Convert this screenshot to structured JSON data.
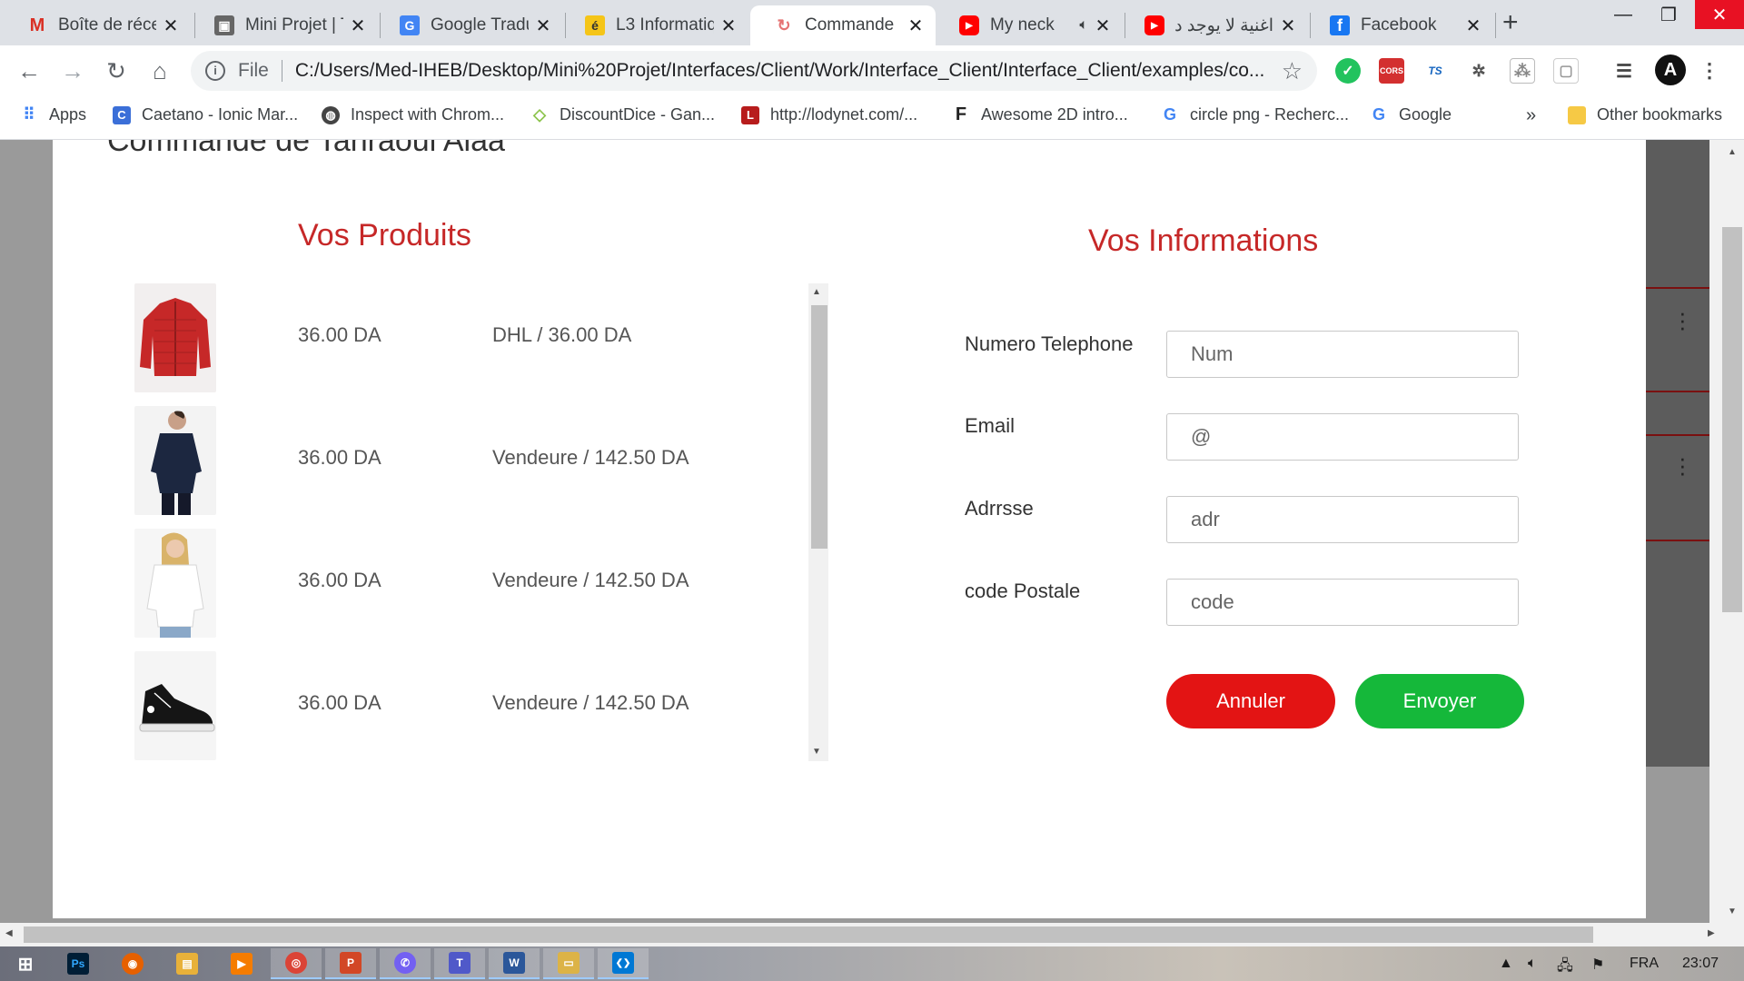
{
  "browser": {
    "tabs": [
      {
        "title": "Boîte de réce",
        "icon": "gmail-icon",
        "color": "#d93025",
        "glyph": "M"
      },
      {
        "title": "Mini Projet | T",
        "icon": "project-icon",
        "color": "#555555",
        "glyph": "▣"
      },
      {
        "title": "Google Tradu",
        "icon": "google-translate-icon",
        "color": "#4285f4",
        "glyph": "G"
      },
      {
        "title": "L3 Informatiq",
        "icon": "elearning-icon",
        "color": "#f5c518",
        "glyph": "é"
      },
      {
        "title": "Commande",
        "icon": "page-loading-icon",
        "color": "#e57373",
        "glyph": "↻"
      },
      {
        "title": "My neck",
        "icon": "youtube-icon",
        "color": "#ff0000",
        "glyph": "▶"
      },
      {
        "title": "اغنية لا يوجد د",
        "icon": "youtube-icon",
        "color": "#ff0000",
        "glyph": "▶"
      },
      {
        "title": "Facebook",
        "icon": "facebook-icon",
        "color": "#1877f2",
        "glyph": "f"
      }
    ],
    "active_tab": 4,
    "new_tab_label": "+",
    "url_scheme": "File",
    "url": "C:/Users/Med-IHEB/Desktop/Mini%20Projet/Interfaces/Client/Work/Interface_Client/Interface_Client/examples/co...",
    "bookmarks": [
      {
        "label": "Apps",
        "icon": "apps-grid-icon",
        "color": "#4285f4"
      },
      {
        "label": "Caetano - Ionic Mar...",
        "icon": "caetano-icon",
        "color": "#3b6fd8"
      },
      {
        "label": "Inspect with Chrom...",
        "icon": "globe-icon",
        "color": "#444444"
      },
      {
        "label": "DiscountDice - Gan...",
        "icon": "discountdice-icon",
        "color": "#8bc34a"
      },
      {
        "label": "http://lodynet.com/...",
        "icon": "lodynet-icon",
        "color": "#b71c1c"
      },
      {
        "label": "Awesome 2D intro...",
        "icon": "flag-f-icon",
        "color": "#222222"
      },
      {
        "label": "circle png - Recherc...",
        "icon": "google-icon",
        "color": "#4285f4"
      },
      {
        "label": "Google",
        "icon": "google-icon",
        "color": "#4285f4"
      }
    ],
    "bookmarks_overflow": "»",
    "other_bookmarks": "Other bookmarks"
  },
  "modal": {
    "title": "Commande de Tahraoui Alaa",
    "products_title": "Vos Produits",
    "info_title": "Vos Informations",
    "products": [
      {
        "price": "36.00 DA",
        "shipping": "DHL / 36.00 DA",
        "image": "red-jacket-image"
      },
      {
        "price": "36.00 DA",
        "shipping": "Vendeure / 142.50 DA",
        "image": "navy-jacket-image"
      },
      {
        "price": "36.00 DA",
        "shipping": "Vendeure / 142.50 DA",
        "image": "white-shirt-image"
      },
      {
        "price": "36.00 DA",
        "shipping": "Vendeure / 142.50 DA",
        "image": "black-sneaker-image"
      }
    ],
    "form": {
      "phone": {
        "label": "Numero Telephone",
        "placeholder": "Num"
      },
      "email": {
        "label": "Email",
        "placeholder": "@"
      },
      "address": {
        "label": "Adrrsse",
        "placeholder": "adr"
      },
      "postal": {
        "label": "code Postale",
        "placeholder": "code"
      }
    },
    "cancel_label": "Annuler",
    "submit_label": "Envoyer",
    "cancel_color": "#e31414",
    "submit_color": "#15b83a"
  },
  "taskbar": {
    "apps": [
      {
        "icon": "windows-start-icon",
        "color": "#ffffff",
        "glyph": "⊞"
      },
      {
        "icon": "photoshop-icon",
        "color": "#001e36",
        "glyph": "Ps"
      },
      {
        "icon": "firefox-icon",
        "color": "#e66000",
        "glyph": "◉"
      },
      {
        "icon": "file-explorer-icon",
        "color": "#e8b13a",
        "glyph": "▤"
      },
      {
        "icon": "media-player-icon",
        "color": "#f57c00",
        "glyph": "▶"
      },
      {
        "icon": "chrome-icon",
        "color": "#db4437",
        "glyph": "◎"
      },
      {
        "icon": "powerpoint-icon",
        "color": "#d24726",
        "glyph": "P"
      },
      {
        "icon": "viber-icon",
        "color": "#7360f2",
        "glyph": "✆"
      },
      {
        "icon": "teams-icon",
        "color": "#5059c9",
        "glyph": "T"
      },
      {
        "icon": "word-icon",
        "color": "#2b579a",
        "glyph": "W"
      },
      {
        "icon": "folder-icon",
        "color": "#dcb347",
        "glyph": "▭"
      },
      {
        "icon": "vscode-icon",
        "color": "#0078d4",
        "glyph": "❮❯"
      }
    ],
    "language": "FRA",
    "time": "23:07"
  }
}
